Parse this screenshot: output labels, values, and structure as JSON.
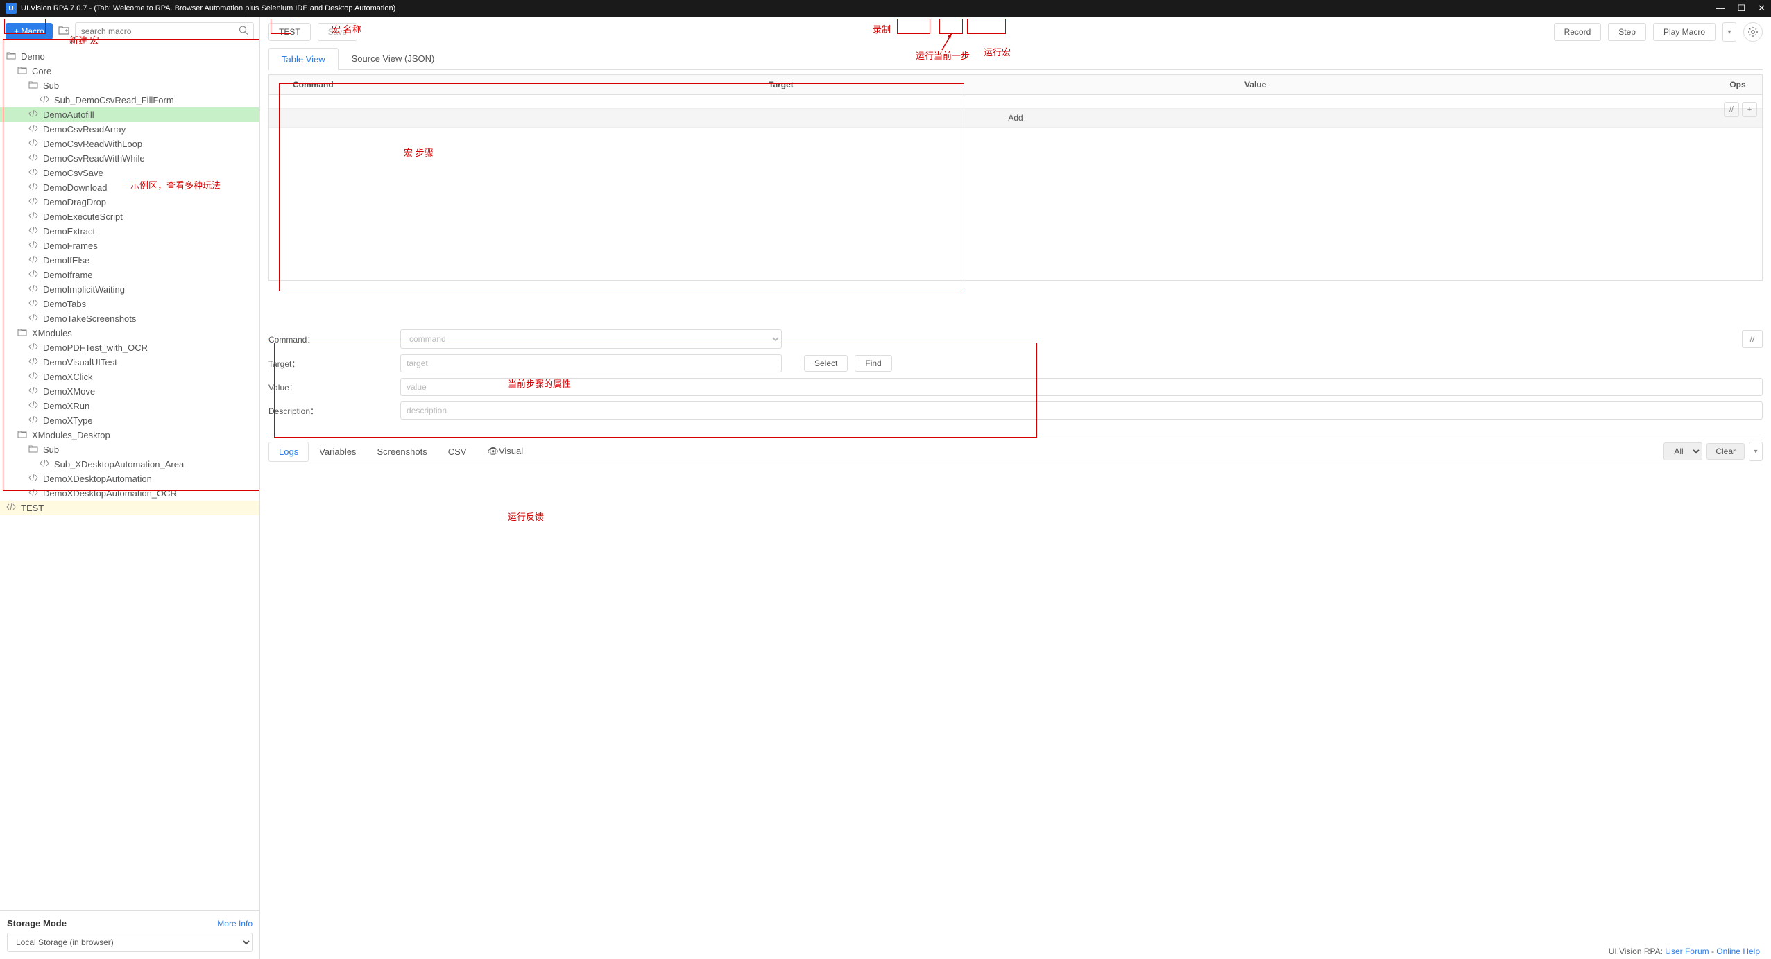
{
  "titlebar": {
    "icon": "U",
    "text": "UI.Vision RPA 7.0.7 - (Tab: Welcome to RPA. Browser Automation plus Selenium IDE and Desktop Automation)"
  },
  "sidebar": {
    "macro_btn": "+ Macro",
    "search_placeholder": "search macro",
    "storage_title": "Storage Mode",
    "storage_more": "More Info",
    "storage_value": "Local Storage (in browser)"
  },
  "tree": [
    {
      "indent": 0,
      "icon": "folder-open",
      "label": "Demo"
    },
    {
      "indent": 1,
      "icon": "folder-open",
      "label": "Core"
    },
    {
      "indent": 2,
      "icon": "folder-open",
      "label": "Sub"
    },
    {
      "indent": 3,
      "icon": "code",
      "label": "Sub_DemoCsvRead_FillForm"
    },
    {
      "indent": 2,
      "icon": "code",
      "label": "DemoAutofill",
      "active": true
    },
    {
      "indent": 2,
      "icon": "code",
      "label": "DemoCsvReadArray"
    },
    {
      "indent": 2,
      "icon": "code",
      "label": "DemoCsvReadWithLoop"
    },
    {
      "indent": 2,
      "icon": "code",
      "label": "DemoCsvReadWithWhile"
    },
    {
      "indent": 2,
      "icon": "code",
      "label": "DemoCsvSave"
    },
    {
      "indent": 2,
      "icon": "code",
      "label": "DemoDownload"
    },
    {
      "indent": 2,
      "icon": "code",
      "label": "DemoDragDrop"
    },
    {
      "indent": 2,
      "icon": "code",
      "label": "DemoExecuteScript"
    },
    {
      "indent": 2,
      "icon": "code",
      "label": "DemoExtract"
    },
    {
      "indent": 2,
      "icon": "code",
      "label": "DemoFrames"
    },
    {
      "indent": 2,
      "icon": "code",
      "label": "DemoIfElse"
    },
    {
      "indent": 2,
      "icon": "code",
      "label": "DemoIframe"
    },
    {
      "indent": 2,
      "icon": "code",
      "label": "DemoImplicitWaiting"
    },
    {
      "indent": 2,
      "icon": "code",
      "label": "DemoTabs"
    },
    {
      "indent": 2,
      "icon": "code",
      "label": "DemoTakeScreenshots"
    },
    {
      "indent": 1,
      "icon": "folder-open",
      "label": "XModules"
    },
    {
      "indent": 2,
      "icon": "code",
      "label": "DemoPDFTest_with_OCR"
    },
    {
      "indent": 2,
      "icon": "code",
      "label": "DemoVisualUITest"
    },
    {
      "indent": 2,
      "icon": "code",
      "label": "DemoXClick"
    },
    {
      "indent": 2,
      "icon": "code",
      "label": "DemoXMove"
    },
    {
      "indent": 2,
      "icon": "code",
      "label": "DemoXRun"
    },
    {
      "indent": 2,
      "icon": "code",
      "label": "DemoXType"
    },
    {
      "indent": 1,
      "icon": "folder-open",
      "label": "XModules_Desktop"
    },
    {
      "indent": 2,
      "icon": "folder-open",
      "label": "Sub"
    },
    {
      "indent": 3,
      "icon": "code",
      "label": "Sub_XDesktopAutomation_Area"
    },
    {
      "indent": 2,
      "icon": "code",
      "label": "DemoXDesktopAutomation"
    },
    {
      "indent": 2,
      "icon": "code",
      "label": "DemoXDesktopAutomation_OCR"
    },
    {
      "indent": 0,
      "icon": "code",
      "label": "TEST",
      "highlight": true
    }
  ],
  "toolbar": {
    "test": "TEST",
    "save": "Save",
    "record": "Record",
    "step": "Step",
    "play": "Play Macro"
  },
  "tabs": {
    "table": "Table View",
    "source": "Source View (JSON)"
  },
  "grid": {
    "cmd": "Command",
    "tgt": "Target",
    "val": "Value",
    "ops": "Ops",
    "add": "Add"
  },
  "props": {
    "cmd_label": "Command：",
    "cmd_ph": "command",
    "tgt_label": "Target：",
    "tgt_ph": "target",
    "val_label": "Value：",
    "val_ph": "value",
    "desc_label": "Description：",
    "desc_ph": "description",
    "select": "Select",
    "find": "Find"
  },
  "bottom": {
    "logs": "Logs",
    "vars": "Variables",
    "shots": "Screenshots",
    "csv": "CSV",
    "visual": "👁Visual",
    "all": "All",
    "clear": "Clear"
  },
  "footer": {
    "prefix": "UI.Vision RPA: ",
    "link1": "User Forum",
    "sep": " - ",
    "link2": "Online Help"
  },
  "annotations": {
    "new_macro": "新建 宏",
    "macro_name": "宏 名称",
    "record": "录制",
    "run_step": "运行当前一步",
    "run_macro": "运行宏",
    "demo_area": "示例区，查看多种玩法",
    "macro_steps": "宏 步骤",
    "step_props": "当前步骤的属性",
    "feedback": "运行反馈"
  }
}
